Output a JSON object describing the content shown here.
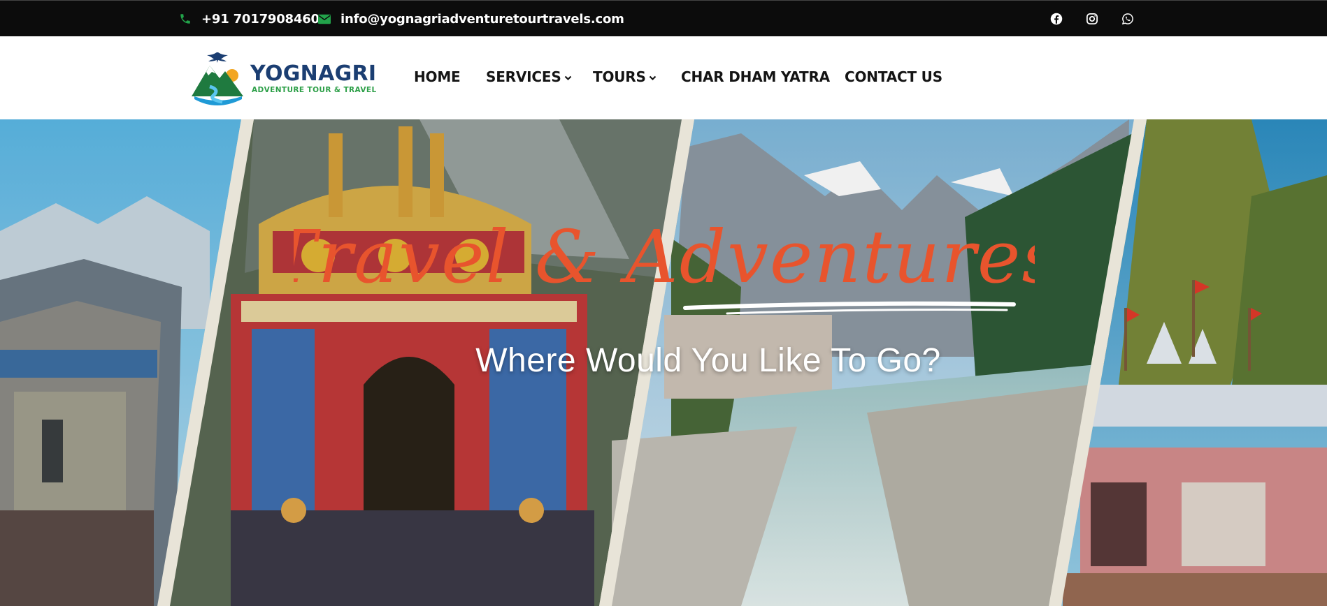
{
  "topbar": {
    "phone": "+91 7017908460",
    "email": "info@yognagriadventuretourtravels.com",
    "social": [
      "facebook-icon",
      "instagram-icon",
      "whatsapp-icon"
    ],
    "icon_color": "#22a34a"
  },
  "brand": {
    "name": "YOGNAGRI",
    "tagline": "ADVENTURE TOUR & TRAVEL",
    "name_color": "#1b3e72",
    "tagline_color": "#2d9f48"
  },
  "nav": {
    "home": "HOME",
    "services": "SERVICES",
    "tours": "TOURS",
    "char_dham": "CHAR DHAM YATRA",
    "contact": "CONTACT US"
  },
  "hero": {
    "script_title": "Travel & Adventures",
    "subtitle": "Where Would You Like To Go?",
    "script_color": "#e8542d"
  }
}
